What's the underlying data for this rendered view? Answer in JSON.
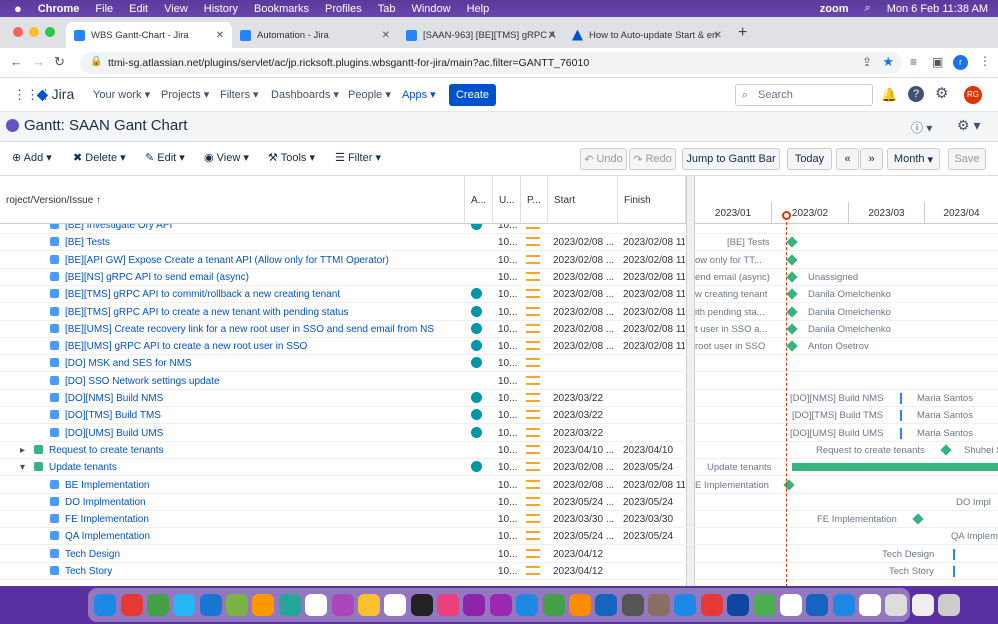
{
  "menubar": {
    "app": "Chrome",
    "items": [
      "File",
      "Edit",
      "View",
      "History",
      "Bookmarks",
      "Profiles",
      "Tab",
      "Window",
      "Help"
    ],
    "zoom": "zoom",
    "datetime": "Mon 6 Feb  11:38 AM"
  },
  "tabs": [
    {
      "label": "WBS Gantt-Chart - Jira"
    },
    {
      "label": "Automation - Jira"
    },
    {
      "label": "[SAAN-963] [BE][TMS] gRPC A"
    },
    {
      "label": "How to Auto-update Start & en"
    }
  ],
  "url": "ttmi-sg.atlassian.net/plugins/servlet/ac/jp.ricksoft.plugins.wbsgantt-for-jira/main?ac.filter=GANTT_76010",
  "jira": {
    "logo": "Jira",
    "nav": [
      "Your work",
      "Projects",
      "Filters",
      "Dashboards",
      "People",
      "Apps"
    ],
    "create": "Create",
    "search": "Search",
    "user": "RG"
  },
  "gantt": {
    "title": "Gantt:  SAAN Gant Chart"
  },
  "toolbar": {
    "add": "Add",
    "delete": "Delete",
    "edit": "Edit",
    "view": "View",
    "tools": "Tools",
    "filter": "Filter",
    "undo": "Undo",
    "redo": "Redo",
    "jump": "Jump to Gantt Bar",
    "today": "Today",
    "prev": "«",
    "next": "»",
    "scale": "Month",
    "save": "Save"
  },
  "columns": {
    "issue": "roject/Version/Issue ↑",
    "assignee": "A...",
    "u": "U...",
    "p": "P...",
    "start": "Start",
    "finish": "Finish"
  },
  "years": [
    "2023/01",
    "2023/02",
    "2023/03",
    "2023/04"
  ],
  "rows": [
    {
      "summary": "[BE] Investigate Ory API",
      "u": "10...",
      "start": "",
      "finish": "",
      "glabel": "",
      "gassignee": ""
    },
    {
      "summary": "[BE] Tests",
      "u": "10...",
      "start": "2023/02/08 ...",
      "finish": "2023/02/08 11:",
      "glabel": "[BE] Tests",
      "gassignee": ""
    },
    {
      "summary": "[BE][API GW] Expose Create a tenant API (Allow only for TTMI Operator)",
      "u": "10...",
      "start": "2023/02/08 ...",
      "finish": "2023/02/08 11:",
      "glabel": "ow only for TT...",
      "gassignee": ""
    },
    {
      "summary": "[BE][NS] gRPC API to send email (async)",
      "u": "10...",
      "start": "2023/02/08 ...",
      "finish": "2023/02/08 11:",
      "glabel": "end email (async)",
      "gassignee": "Unassigned"
    },
    {
      "summary": "[BE][TMS] gRPC API to commit/rollback a new creating tenant",
      "u": "10...",
      "start": "2023/02/08 ...",
      "finish": "2023/02/08 11:",
      "glabel": "w creating tenant",
      "gassignee": "Danila Omelchenko"
    },
    {
      "summary": "[BE][TMS] gRPC API to create a new tenant with pending status",
      "u": "10...",
      "start": "2023/02/08 ...",
      "finish": "2023/02/08 11:",
      "glabel": "ith pending sta...",
      "gassignee": "Danila Omelchenko"
    },
    {
      "summary": "[BE][UMS] Create recovery link for a new root user in SSO and send email from NS",
      "u": "10...",
      "start": "2023/02/08 ...",
      "finish": "2023/02/08 11:",
      "glabel": "t user in SSO a...",
      "gassignee": "Danila Omelchenko"
    },
    {
      "summary": "[BE][UMS] gRPC API to create a new root user in SSO",
      "u": "10...",
      "start": "2023/02/08 ...",
      "finish": "2023/02/08 11:",
      "glabel": "root user in SSO",
      "gassignee": "Anton Osetrov"
    },
    {
      "summary": "[DO] MSK and SES for NMS",
      "u": "10...",
      "start": "",
      "finish": "",
      "glabel": "",
      "gassignee": ""
    },
    {
      "summary": "[DO] SSO Network settings update",
      "u": "10...",
      "start": "",
      "finish": "",
      "glabel": "",
      "gassignee": ""
    },
    {
      "summary": "[DO][NMS] Build NMS",
      "u": "10...",
      "start": "2023/03/22",
      "finish": "",
      "glabel": "[DO][NMS] Build NMS",
      "gassignee": "Maria Santos"
    },
    {
      "summary": "[DO][TMS] Build TMS",
      "u": "10...",
      "start": "2023/03/22",
      "finish": "",
      "glabel": "[DO][TMS] Build TMS",
      "gassignee": "Maria Santos"
    },
    {
      "summary": "[DO][UMS] Build UMS",
      "u": "10...",
      "start": "2023/03/22",
      "finish": "",
      "glabel": "[DO][UMS] Build UMS",
      "gassignee": "Maria Santos"
    },
    {
      "summary": "Request to create tenants",
      "u": "10...",
      "start": "2023/04/10 ...",
      "finish": "2023/04/10",
      "glabel": "Request to create tenants",
      "gassignee": "Shuhei S"
    },
    {
      "summary": "Update tenants",
      "u": "10...",
      "start": "2023/02/08 ...",
      "finish": "2023/05/24",
      "glabel": "Update tenants",
      "gassignee": ""
    },
    {
      "summary": "BE Implementation",
      "u": "10...",
      "start": "2023/02/08 ...",
      "finish": "2023/02/08 11:",
      "glabel": "E Implementation",
      "gassignee": ""
    },
    {
      "summary": "DO Implmentation",
      "u": "10...",
      "start": "2023/05/24 ...",
      "finish": "2023/05/24",
      "glabel": "DO Impl",
      "gassignee": ""
    },
    {
      "summary": "FE Implementation",
      "u": "10...",
      "start": "2023/03/30 ...",
      "finish": "2023/03/30",
      "glabel": "FE Implementation",
      "gassignee": ""
    },
    {
      "summary": "QA Implementation",
      "u": "10...",
      "start": "2023/05/24 ...",
      "finish": "2023/05/24",
      "glabel": "QA Implem",
      "gassignee": ""
    },
    {
      "summary": "Tech Design",
      "u": "10...",
      "start": "2023/04/12",
      "finish": "",
      "glabel": "Tech Design",
      "gassignee": ""
    },
    {
      "summary": "Tech Story",
      "u": "10...",
      "start": "2023/04/12",
      "finish": "",
      "glabel": "Tech Story",
      "gassignee": ""
    }
  ]
}
